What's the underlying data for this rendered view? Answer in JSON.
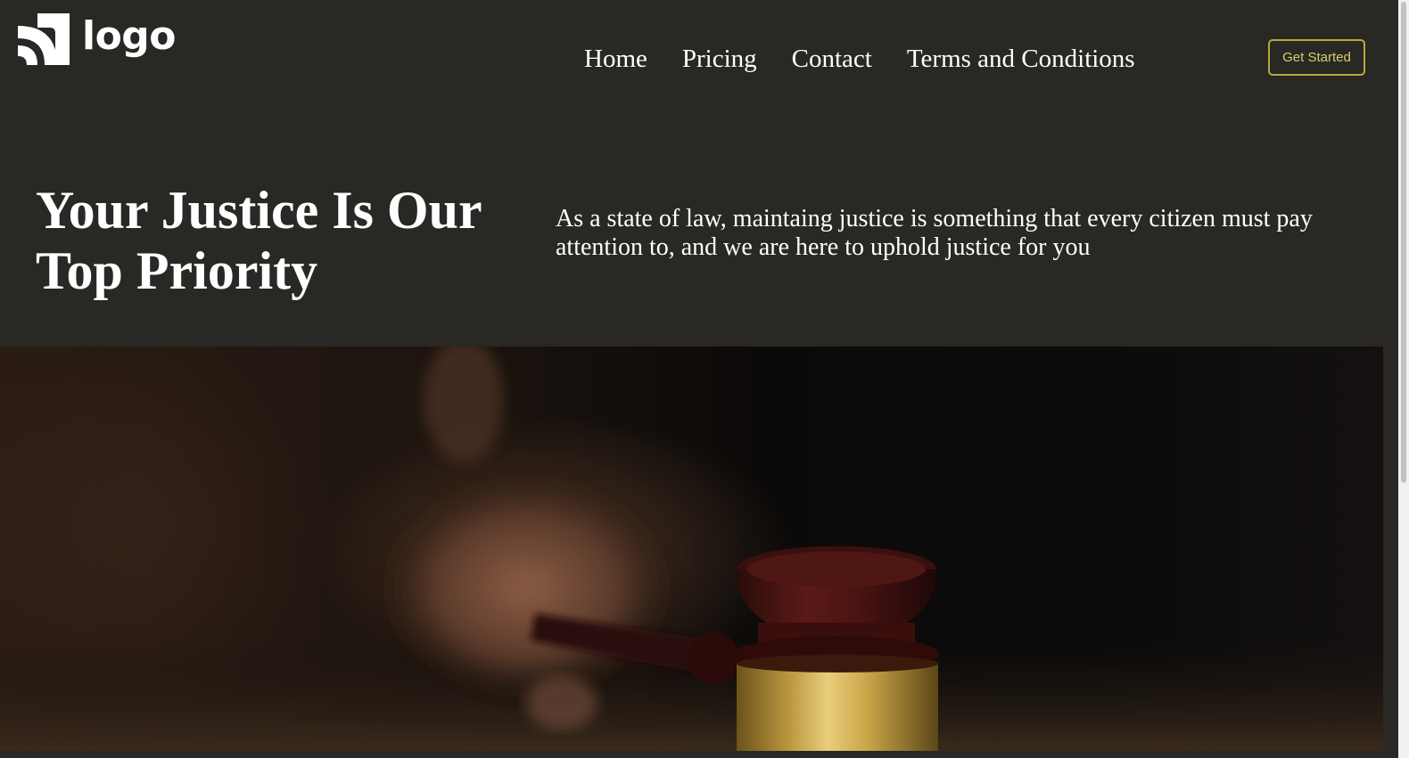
{
  "brand": {
    "logo_text": "logo"
  },
  "nav": {
    "items": [
      "Home",
      "Pricing",
      "Contact",
      "Terms and Conditions"
    ]
  },
  "header": {
    "cta_label": "Get Started"
  },
  "hero": {
    "title_line1": "Your Justice Is Our",
    "title_line2": "Top Priority",
    "subtitle": "As a state of law, maintaing justice is something that every citizen must pay attention to, and we are here to uphold justice for you",
    "image_subject": "judge-gavel-photo"
  },
  "colors": {
    "background": "#292825",
    "text": "#ffffff",
    "accent_border": "#b8a93a",
    "accent_text": "#d8cc6a"
  }
}
